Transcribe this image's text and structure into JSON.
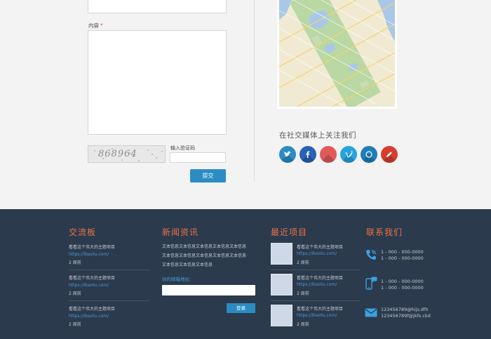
{
  "form": {
    "content_label": "内容",
    "required_mark": "*",
    "captcha_text": "868964",
    "captcha_label": "输入验证码",
    "submit_label": "提交"
  },
  "social": {
    "title": "在社交媒体上关注我们",
    "icons": [
      {
        "name": "twitter-bird-icon",
        "color": "#2b8cc4"
      },
      {
        "name": "facebook-icon",
        "color": "#2763b6"
      },
      {
        "name": "google-plus-icon",
        "color": "#e05a5a"
      },
      {
        "name": "vimeo-icon",
        "color": "#27a4df"
      },
      {
        "name": "skype-icon",
        "color": "#1d7fb8"
      },
      {
        "name": "pencil-icon",
        "color": "#d63d2c"
      }
    ]
  },
  "footer": {
    "board": {
      "title": "交流板",
      "items": [
        {
          "text": "看看这个伟大的主题项目",
          "link": "https://ibaotu.com/",
          "time": "2 周前"
        },
        {
          "text": "看看这个伟大的主题项目",
          "link": "https://ibaotu.com/",
          "time": "2 周前"
        },
        {
          "text": "看看这个伟大的主题项目",
          "link": "https://ibaotu.com/",
          "time": "2 周前"
        }
      ]
    },
    "news": {
      "title": "新闻资讯",
      "lines": [
        "文本信息文本信息文本信息文本信息文本信息",
        "文本信息文本信息文本信息文本信息文本信息",
        "文本信息文本信息文本信息"
      ],
      "email_label": "你的邮箱地址：",
      "login_label": "登录"
    },
    "projects": {
      "title": "最近项目",
      "items": [
        {
          "text": "看看这个伟大的主题项目",
          "link": "https://ibaotu.com/",
          "time": "2 周前"
        },
        {
          "text": "看看这个伟大的主题项目",
          "link": "https://ibaotu.com/",
          "time": "2 周前"
        },
        {
          "text": "看看这个伟大的主题项目",
          "link": "https://ibaotu.com/",
          "time": "2 周前"
        }
      ]
    },
    "contact": {
      "title": "联系我们",
      "phone": [
        "1 - 000 - 000-0000",
        "1 - 000 - 000-0000"
      ],
      "mobile": [
        "1 - 000 - 000-0000",
        "1 - 000 - 000-0000"
      ],
      "email": [
        "123456789@hijs.dfh",
        "123456789f@jkfs.ckd"
      ]
    }
  },
  "colors": {
    "accent": "#2b8cc4",
    "footer_bg": "#2b3a4c",
    "footer_title": "#e8734a",
    "link": "#4a9bd9"
  }
}
